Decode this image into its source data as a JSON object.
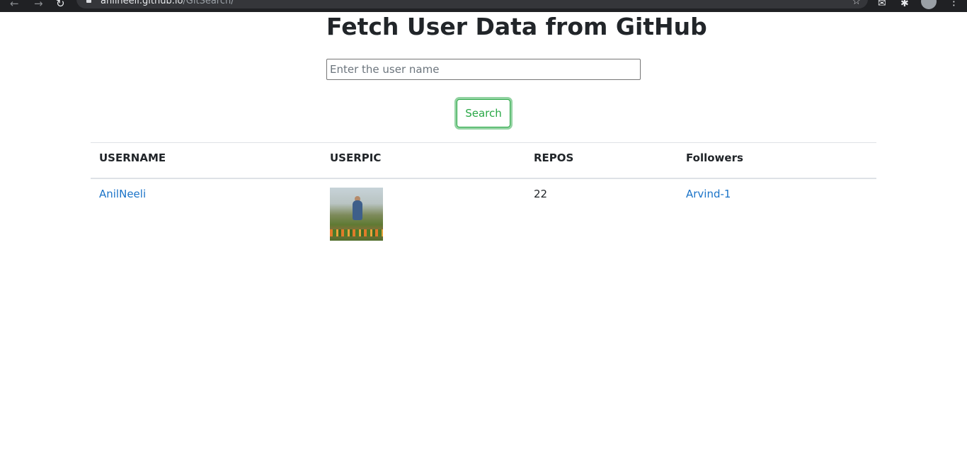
{
  "browser": {
    "url_host": "anilneeli.github.io",
    "url_path": "/GitSearch/"
  },
  "page": {
    "title": "Fetch User Data from GitHub",
    "search": {
      "value": "",
      "placeholder": "Enter the user name"
    },
    "search_button_label": "Search"
  },
  "table": {
    "headers": {
      "username": "USERNAME",
      "userpic": "USERPIC",
      "repos": "REPOS",
      "followers": "Followers"
    },
    "rows": [
      {
        "username": "AnilNeeli",
        "repos": "22",
        "followers": "Arvind-1"
      }
    ]
  },
  "colors": {
    "accent_green": "#28a745",
    "link_blue": "#1a73c8",
    "text": "#212529"
  }
}
